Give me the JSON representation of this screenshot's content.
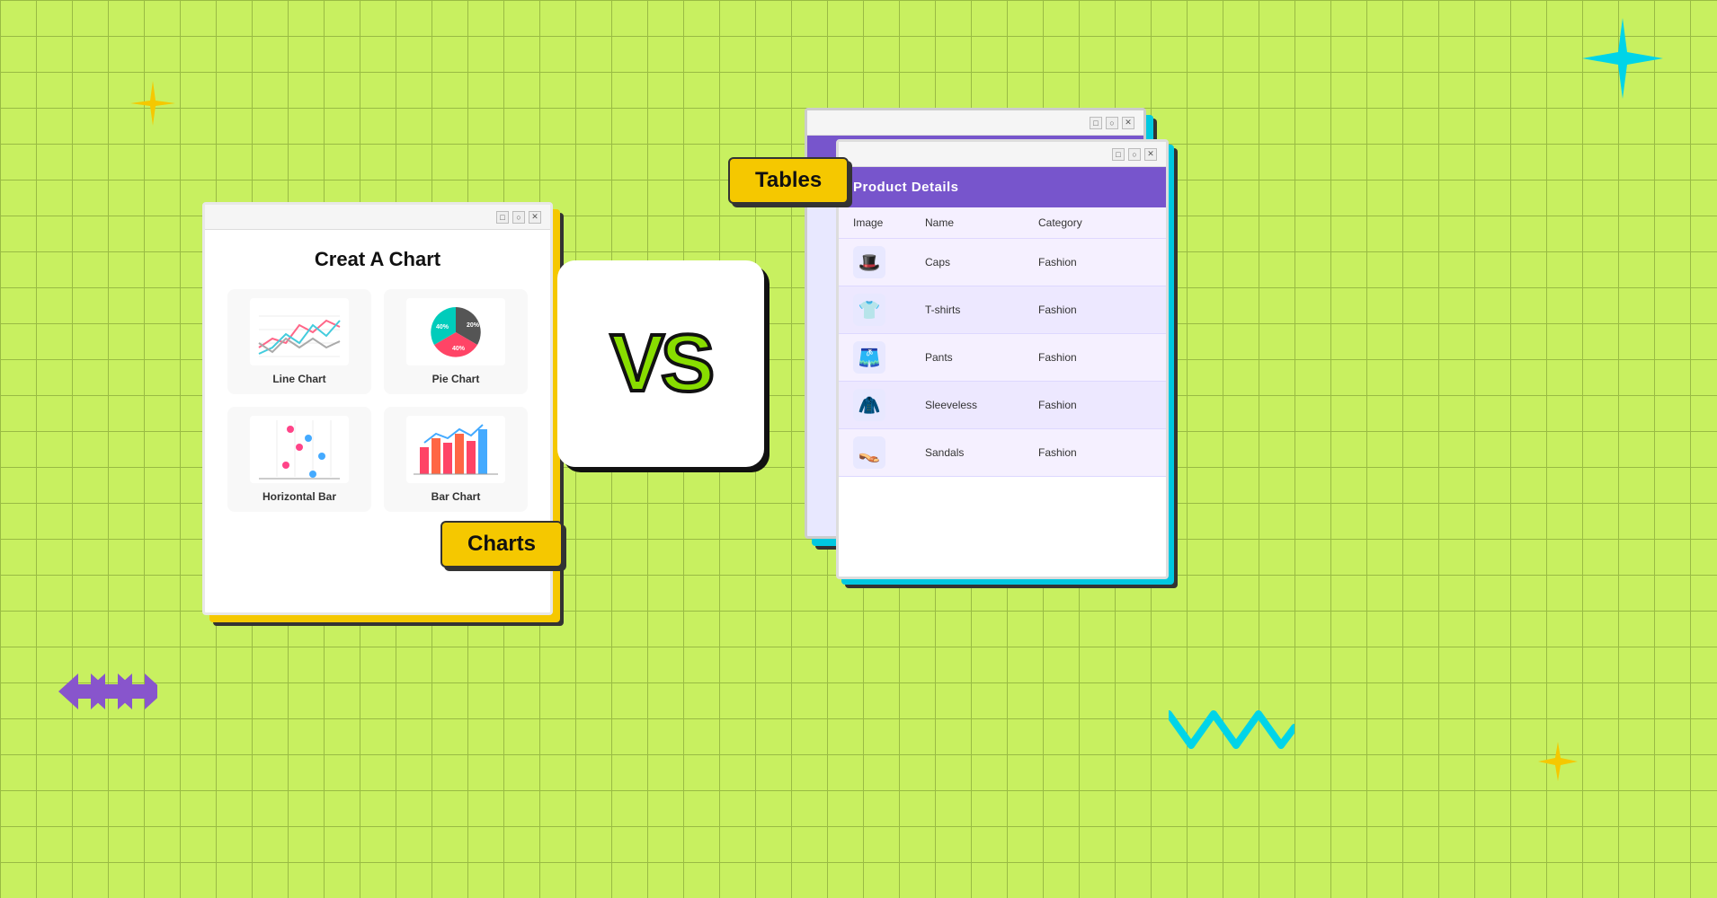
{
  "background": {
    "color": "#c8f060"
  },
  "vs_label": "VS",
  "charts_window": {
    "title": "Creat A Chart",
    "charts": [
      {
        "id": "line-chart",
        "label": "Line Chart"
      },
      {
        "id": "pie-chart",
        "label": "Pie Chart"
      },
      {
        "id": "horizontal-bar",
        "label": "Horizontal Bar"
      },
      {
        "id": "bar-chart",
        "label": "Bar Chart"
      }
    ],
    "badge": "Charts"
  },
  "table_window": {
    "header": "Product Details",
    "columns": [
      "Image",
      "Name",
      "Category"
    ],
    "rows": [
      {
        "icon": "🎩",
        "name": "Caps",
        "category": "Fashion"
      },
      {
        "icon": "👕",
        "name": "T-shirts",
        "category": "Fashion"
      },
      {
        "icon": "🩳",
        "name": "Pants",
        "category": "Fashion"
      },
      {
        "icon": "🧥",
        "name": "Sleeveless",
        "category": "Fashion"
      },
      {
        "icon": "👡",
        "name": "Sandals",
        "category": "Fashion"
      }
    ],
    "badge": "Tables"
  },
  "window_controls": [
    "□",
    "○",
    "✕"
  ]
}
